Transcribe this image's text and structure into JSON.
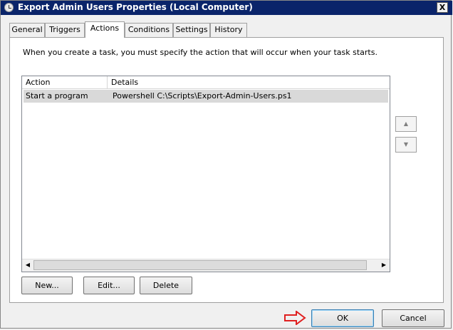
{
  "window": {
    "title": "Export Admin Users Properties (Local Computer)",
    "close_glyph": "X"
  },
  "tabs": [
    {
      "label": "General"
    },
    {
      "label": "Triggers"
    },
    {
      "label": "Actions"
    },
    {
      "label": "Conditions"
    },
    {
      "label": "Settings"
    },
    {
      "label": "History"
    }
  ],
  "active_tab": "Actions",
  "panel": {
    "intro": "When you create a task, you must specify the action that will occur when your task starts.",
    "columns": [
      "Action",
      "Details"
    ],
    "rows": [
      {
        "action": "Start a program",
        "details": "Powershell C:\\Scripts\\Export-Admin-Users.ps1",
        "selected": true
      }
    ],
    "buttons": {
      "new": "New...",
      "edit": "Edit...",
      "delete": "Delete"
    },
    "move_up_icon": "up-arrow-icon",
    "move_down_icon": "down-arrow-icon"
  },
  "footer": {
    "ok": "OK",
    "cancel": "Cancel"
  },
  "annotation": {
    "icon": "red-arrow-icon",
    "color": "#e02020"
  },
  "colors": {
    "titlebar": "#0a246a",
    "selected_row": "#d9d9d9"
  }
}
